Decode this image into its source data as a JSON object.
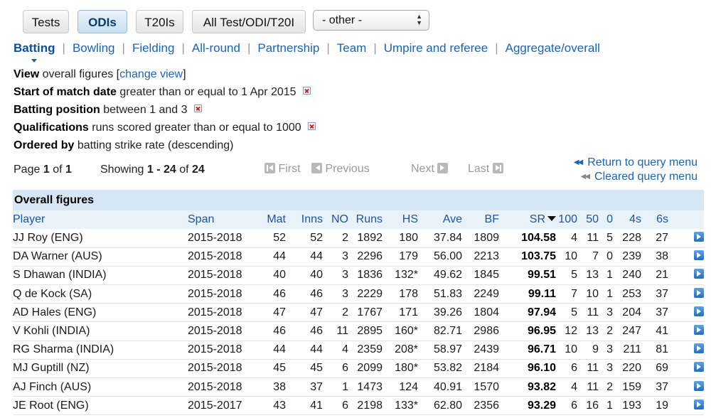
{
  "tabs": [
    "Tests",
    "ODIs",
    "T20Is",
    "All Test/ODI/T20I"
  ],
  "active_tab": "ODIs",
  "other_select": {
    "value": "- other -"
  },
  "nav": {
    "items": [
      "Batting",
      "Bowling",
      "Fielding",
      "All-round",
      "Partnership",
      "Team",
      "Umpire and referee",
      "Aggregate/overall"
    ],
    "active": "Batting"
  },
  "query": {
    "view": {
      "label": "View",
      "text": "overall figures [",
      "link": "change view",
      "close": "]"
    },
    "start_date": {
      "label": "Start of match date",
      "text": "greater than or equal to 1 Apr 2015"
    },
    "batting_position": {
      "label": "Batting position",
      "text": "between 1 and 3"
    },
    "qualifications": {
      "label": "Qualifications",
      "text": "runs scored greater than or equal to 1000"
    },
    "ordered_by": {
      "label": "Ordered by",
      "text": "batting strike rate (descending)"
    }
  },
  "paging": {
    "page_label": "Page",
    "page": "1",
    "of_label": "of",
    "total_pages": "1",
    "showing_label": "Showing",
    "from": "1",
    "dash": "-",
    "to": "24",
    "of2": "of",
    "total": "24",
    "first": "First",
    "previous": "Previous",
    "next": "Next",
    "last": "Last"
  },
  "links": {
    "return_query": "Return to query menu",
    "cleared_query": "Cleared query menu"
  },
  "table": {
    "title": "Overall figures",
    "headers": [
      "Player",
      "Span",
      "Mat",
      "Inns",
      "NO",
      "Runs",
      "HS",
      "Ave",
      "BF",
      "SR",
      "100",
      "50",
      "0",
      "4s",
      "6s"
    ],
    "sorted_column": "SR",
    "rows": [
      [
        "JJ Roy (ENG)",
        "2015-2018",
        "52",
        "52",
        "2",
        "1892",
        "180",
        "37.84",
        "1809",
        "104.58",
        "4",
        "11",
        "5",
        "228",
        "27"
      ],
      [
        "DA Warner (AUS)",
        "2015-2018",
        "44",
        "44",
        "3",
        "2296",
        "179",
        "56.00",
        "2213",
        "103.75",
        "10",
        "7",
        "0",
        "239",
        "38"
      ],
      [
        "S Dhawan (INDIA)",
        "2015-2018",
        "40",
        "40",
        "3",
        "1836",
        "132*",
        "49.62",
        "1845",
        "99.51",
        "5",
        "13",
        "1",
        "240",
        "21"
      ],
      [
        "Q de Kock (SA)",
        "2015-2018",
        "46",
        "46",
        "3",
        "2229",
        "178",
        "51.83",
        "2249",
        "99.11",
        "7",
        "10",
        "1",
        "253",
        "37"
      ],
      [
        "AD Hales (ENG)",
        "2015-2018",
        "47",
        "47",
        "2",
        "1767",
        "171",
        "39.26",
        "1804",
        "97.94",
        "5",
        "11",
        "3",
        "204",
        "37"
      ],
      [
        "V Kohli (INDIA)",
        "2015-2018",
        "46",
        "46",
        "11",
        "2895",
        "160*",
        "82.71",
        "2986",
        "96.95",
        "12",
        "13",
        "2",
        "247",
        "41"
      ],
      [
        "RG Sharma (INDIA)",
        "2015-2018",
        "44",
        "44",
        "4",
        "2359",
        "208*",
        "58.97",
        "2439",
        "96.71",
        "10",
        "9",
        "3",
        "211",
        "81"
      ],
      [
        "MJ Guptill (NZ)",
        "2015-2018",
        "45",
        "45",
        "6",
        "2099",
        "180*",
        "53.82",
        "2184",
        "96.10",
        "6",
        "11",
        "3",
        "220",
        "69"
      ],
      [
        "AJ Finch (AUS)",
        "2015-2018",
        "38",
        "37",
        "1",
        "1473",
        "124",
        "40.91",
        "1570",
        "93.82",
        "4",
        "11",
        "2",
        "159",
        "37"
      ],
      [
        "JE Root (ENG)",
        "2015-2017",
        "43",
        "41",
        "6",
        "2198",
        "133*",
        "62.80",
        "2356",
        "93.29",
        "6",
        "16",
        "1",
        "193",
        "19"
      ]
    ]
  },
  "colors": {
    "link": "#1a64b3",
    "table_header_bg": "#d7e6f4",
    "active_tab_text": "#0c3c6e"
  }
}
